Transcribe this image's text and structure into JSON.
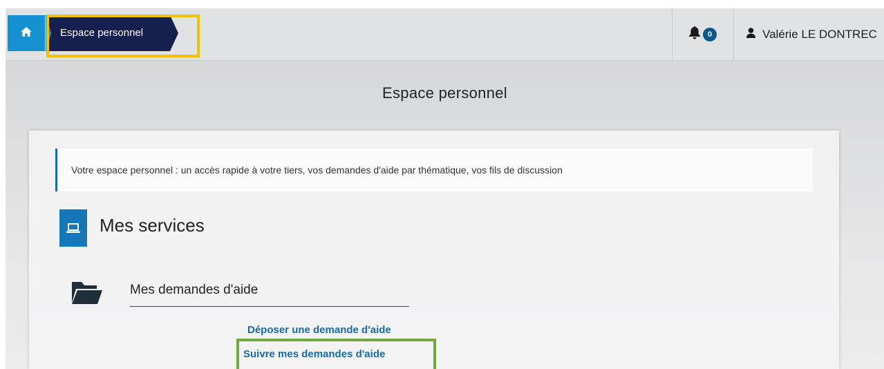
{
  "header": {
    "breadcrumb": "Espace personnel",
    "notification_count": "0",
    "user_name": "Valérie LE DONTREC"
  },
  "main": {
    "page_title": "Espace personnel",
    "info_text": "Votre espace personnel : un accès rapide à votre tiers, vos demandes d'aide par thématique, vos fils de discussion",
    "services_title": "Mes services",
    "demandes_title": "Mes demandes d'aide",
    "links": {
      "deposer": "Déposer une demande d'aide",
      "suivre": "Suivre mes demandes d'aide"
    }
  },
  "icons": {
    "home": "home-icon",
    "bell": "bell-icon",
    "user": "user-icon",
    "laptop": "laptop-icon",
    "folder": "folder-open-icon"
  },
  "colors": {
    "accent_blue": "#1590d0",
    "breadcrumb_navy": "#15204e",
    "highlight_yellow": "#f5c000",
    "highlight_green": "#6fa83f",
    "link_blue": "#1a6aa6"
  }
}
